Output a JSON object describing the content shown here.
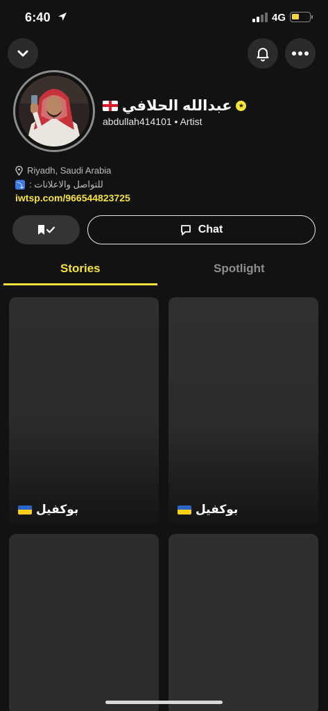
{
  "status_bar": {
    "time": "6:40",
    "network": "4G",
    "battery_color": "#f5d73b"
  },
  "top_bar": {
    "back_icon": "chevron-down-icon",
    "notification_icon": "bell-icon",
    "more_icon": "more-dots-icon"
  },
  "profile": {
    "display_name": "عبدالله الحلافي",
    "username": "abdullah414101",
    "separator": "•",
    "category": "Artist",
    "location": "Riyadh, Saudi Arabia",
    "contact_label": "للتواصل والاعلانات :",
    "link": "iwtsp.com/966544823725"
  },
  "actions": {
    "chat_label": "Chat"
  },
  "tabs": [
    {
      "label": "Stories",
      "active": true
    },
    {
      "label": "Spotlight",
      "active": false
    }
  ],
  "stories": [
    {
      "caption": "بوكفيل"
    },
    {
      "caption": "بوكفيل"
    },
    {
      "caption": ""
    },
    {
      "caption": ""
    }
  ],
  "colors": {
    "accent": "#f5e33b",
    "background": "#121212"
  }
}
